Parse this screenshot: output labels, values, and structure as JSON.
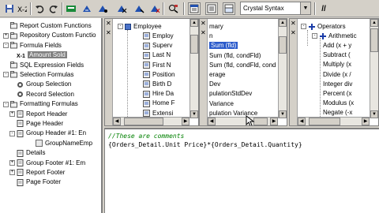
{
  "toolbar": {
    "icons": [
      "save-icon",
      "check-icon",
      "undo-icon",
      "redo-icon",
      "bookmark-icon",
      "bookmark-next-icon",
      "bookmark-prev-icon",
      "clear-bookmarks-icon",
      "find-icon",
      "toggle-tree-icon",
      "toggle-fields-icon",
      "toggle-editor-icon"
    ],
    "syntax": "Crystal Syntax",
    "comment_icon": "//"
  },
  "tree": {
    "items": [
      {
        "label": "Report Custom Functions",
        "level": 1,
        "expander": "",
        "icon": "folder"
      },
      {
        "label": "Repository Custom Functio",
        "level": 1,
        "expander": "+",
        "icon": "folder"
      },
      {
        "label": "Formula Fields",
        "level": 1,
        "expander": "-",
        "icon": "folder"
      },
      {
        "label": "Amount Sold",
        "level": 2,
        "expander": "",
        "icon": "formula",
        "selected": true
      },
      {
        "label": "SQL Expression Fields",
        "level": 1,
        "expander": "",
        "icon": "folder"
      },
      {
        "label": "Selection Formulas",
        "level": 1,
        "expander": "-",
        "icon": "folder"
      },
      {
        "label": "Group Selection",
        "level": 2,
        "expander": "",
        "icon": "gear"
      },
      {
        "label": "Record Selection",
        "level": 2,
        "expander": "",
        "icon": "gear"
      },
      {
        "label": "Formatting Formulas",
        "level": 1,
        "expander": "-",
        "icon": "folder"
      },
      {
        "label": "Report Header",
        "level": 2,
        "expander": "+",
        "icon": "page"
      },
      {
        "label": "Page Header",
        "level": 2,
        "expander": "",
        "icon": "page"
      },
      {
        "label": "Group Header #1: En",
        "level": 2,
        "expander": "-",
        "icon": "page"
      },
      {
        "label": "GroupNameEmp",
        "level": 3,
        "expander": "",
        "icon": "field"
      },
      {
        "label": "Details",
        "level": 2,
        "expander": "",
        "icon": "page"
      },
      {
        "label": "Group Footer #1: Em",
        "level": 2,
        "expander": "+",
        "icon": "page"
      },
      {
        "label": "Report Footer",
        "level": 2,
        "expander": "+",
        "icon": "page"
      },
      {
        "label": "Page Footer",
        "level": 2,
        "expander": "",
        "icon": "page"
      }
    ]
  },
  "fields_panel": {
    "root": "Employee",
    "items": [
      "Employ",
      "Superv",
      "Last N",
      "First N",
      "Position",
      "Birth D",
      "Hire Da",
      "Home F",
      "Extensi"
    ]
  },
  "functions_panel": {
    "items": [
      "mary",
      "n",
      "Sum (fld)",
      "Sum (fld, condFld)",
      "Sum (fld, condFld, cond",
      "erage",
      "Dev",
      "pulationStdDev",
      "Variance",
      "pulation Variance"
    ],
    "selected_index": 2
  },
  "operators_panel": {
    "root": "Operators",
    "group": "Arithmetic",
    "items": [
      "Add (x + y",
      "Subtract (",
      "Multiply (x",
      "Divide (x /",
      "Integer div",
      "Percent (x",
      "Modulus (x",
      "Negate (-x"
    ]
  },
  "editor": {
    "lines": [
      "//These are comments",
      "{Orders_Detail.Unit Price}*{Orders_Detail.Quantity}"
    ]
  }
}
